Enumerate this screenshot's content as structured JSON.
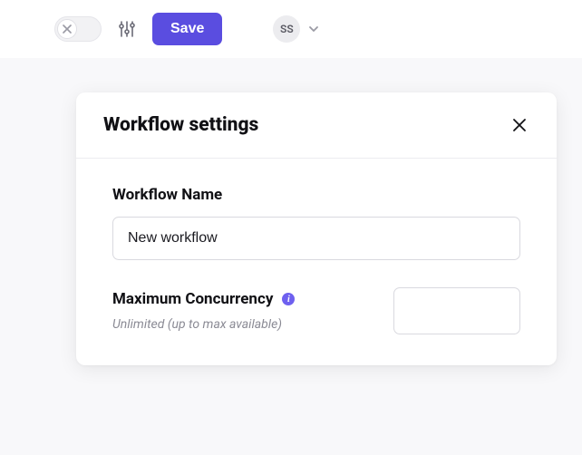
{
  "toolbar": {
    "toggle_state": "off",
    "save_label": "Save",
    "avatar_initials": "SS"
  },
  "panel": {
    "title": "Workflow settings",
    "fields": {
      "workflow_name": {
        "label": "Workflow Name",
        "value": "New workflow"
      },
      "max_concurrency": {
        "label": "Maximum Concurrency",
        "helper": "Unlimited (up to max available)",
        "value": ""
      }
    }
  }
}
